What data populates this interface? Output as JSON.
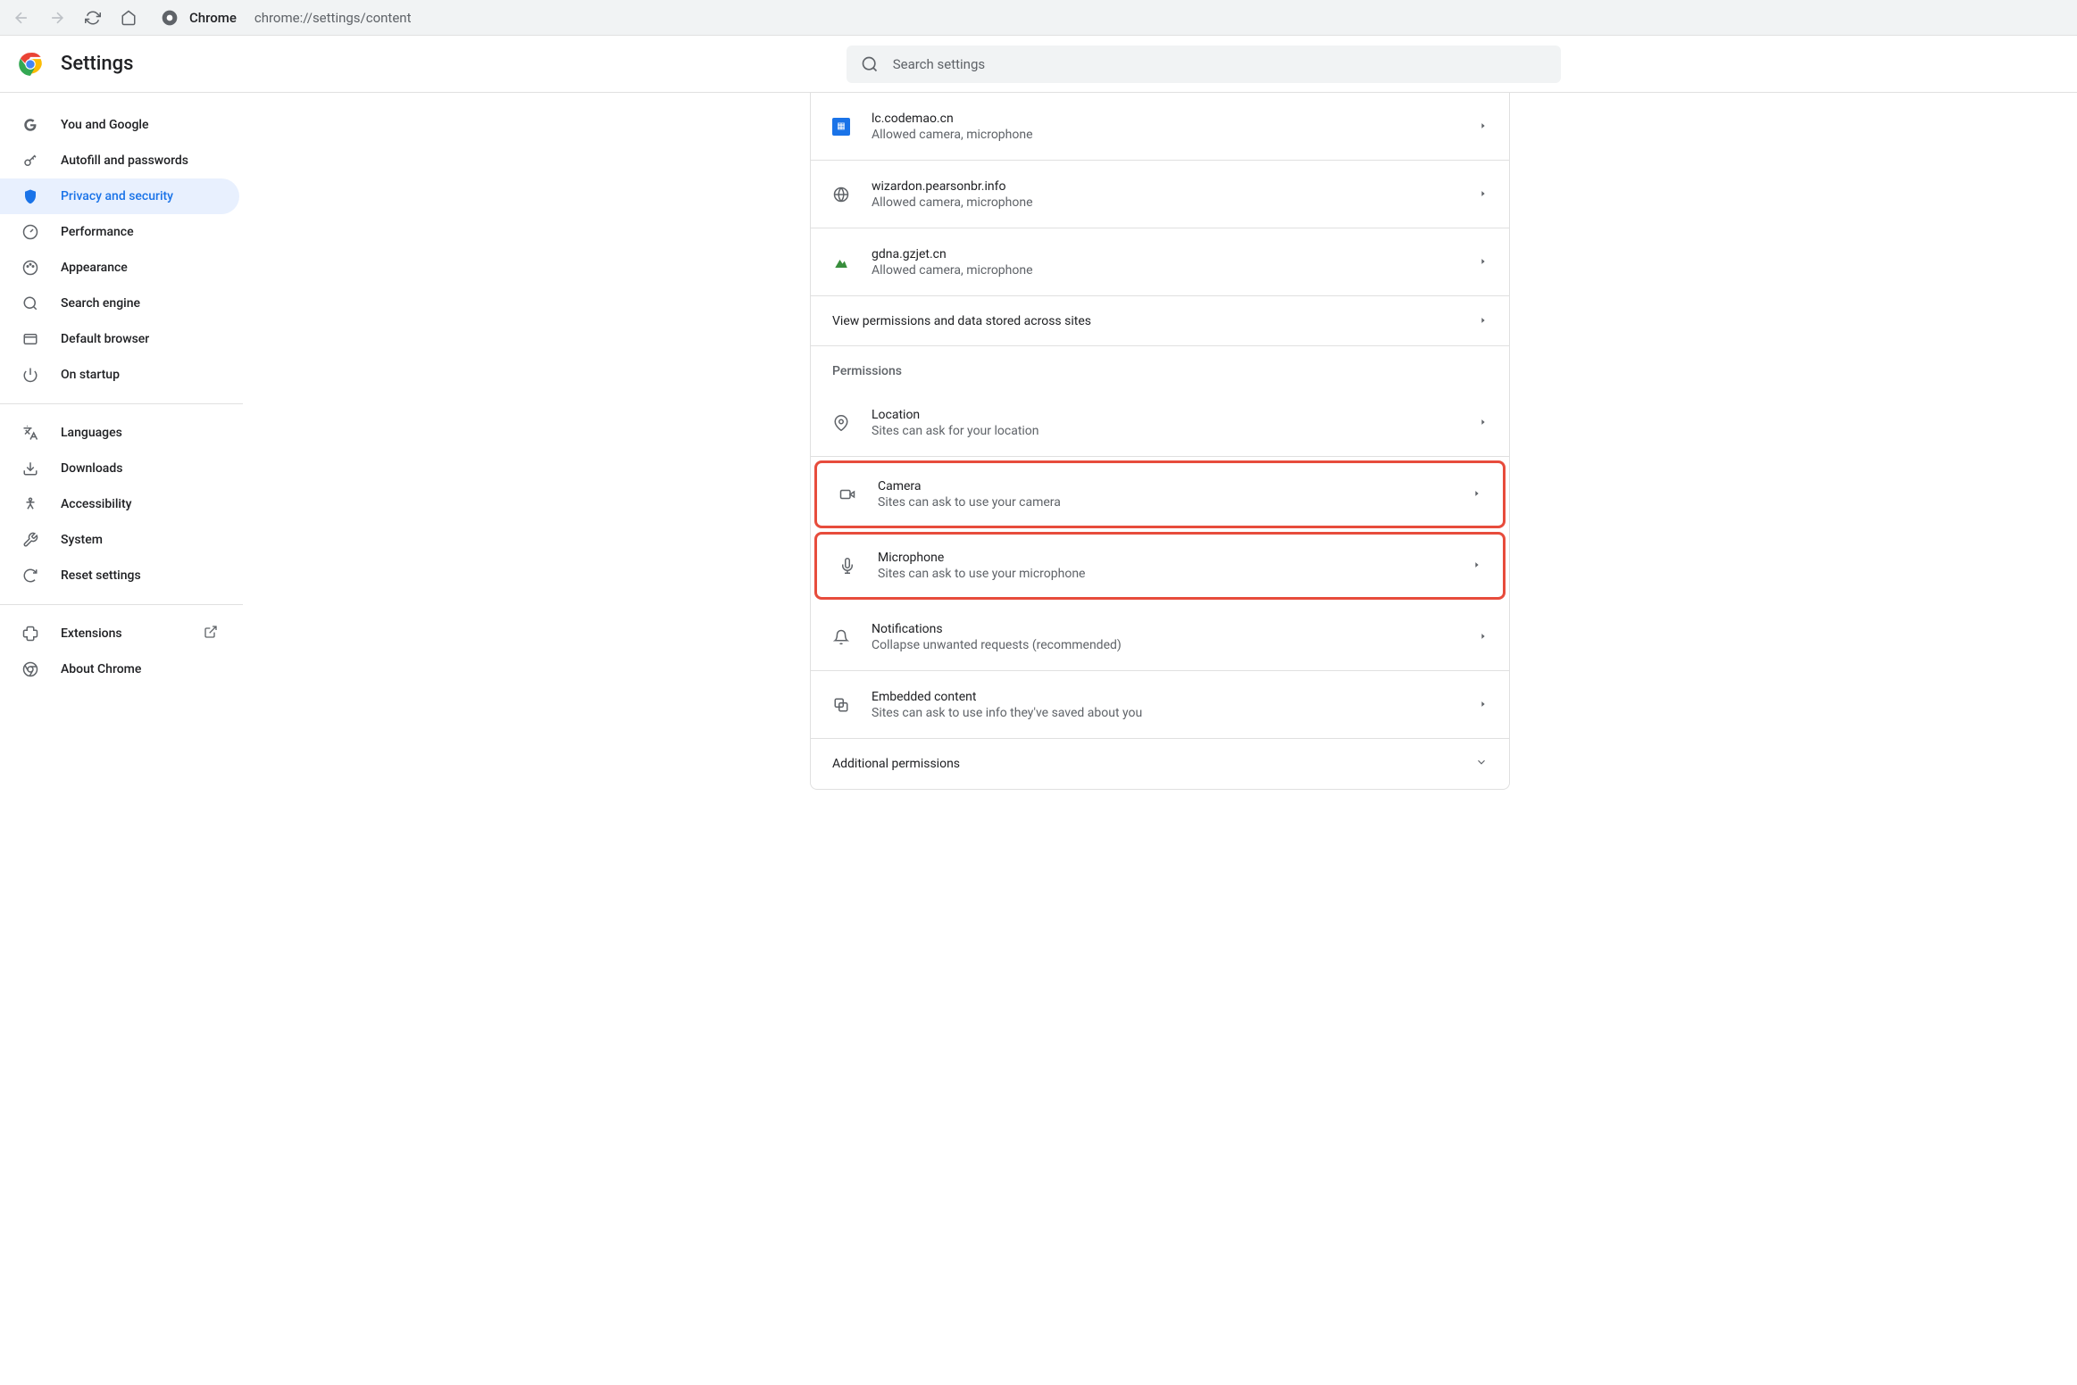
{
  "browser": {
    "label": "Chrome",
    "url": "chrome://settings/content"
  },
  "header": {
    "title": "Settings",
    "search_placeholder": "Search settings"
  },
  "sidebar": {
    "group1": [
      {
        "id": "you-and-google",
        "label": "You and Google"
      },
      {
        "id": "autofill",
        "label": "Autofill and passwords"
      },
      {
        "id": "privacy",
        "label": "Privacy and security",
        "active": true
      },
      {
        "id": "performance",
        "label": "Performance"
      },
      {
        "id": "appearance",
        "label": "Appearance"
      },
      {
        "id": "search-engine",
        "label": "Search engine"
      },
      {
        "id": "default-browser",
        "label": "Default browser"
      },
      {
        "id": "on-startup",
        "label": "On startup"
      }
    ],
    "group2": [
      {
        "id": "languages",
        "label": "Languages"
      },
      {
        "id": "downloads",
        "label": "Downloads"
      },
      {
        "id": "accessibility",
        "label": "Accessibility"
      },
      {
        "id": "system",
        "label": "System"
      },
      {
        "id": "reset",
        "label": "Reset settings"
      }
    ],
    "group3": [
      {
        "id": "extensions",
        "label": "Extensions"
      },
      {
        "id": "about",
        "label": "About Chrome"
      }
    ]
  },
  "content": {
    "recent_sites": [
      {
        "domain": "lc.codemao.cn",
        "status": "Allowed camera, microphone",
        "icon": "blue"
      },
      {
        "domain": "wizardon.pearsonbr.info",
        "status": "Allowed camera, microphone",
        "icon": "globe"
      },
      {
        "domain": "gdna.gzjet.cn",
        "status": "Allowed camera, microphone",
        "icon": "mountain"
      }
    ],
    "view_permissions": "View permissions and data stored across sites",
    "permissions_title": "Permissions",
    "permissions": [
      {
        "id": "location",
        "title": "Location",
        "subtitle": "Sites can ask for your location",
        "highlighted": false
      },
      {
        "id": "camera",
        "title": "Camera",
        "subtitle": "Sites can ask to use your camera",
        "highlighted": true
      },
      {
        "id": "microphone",
        "title": "Microphone",
        "subtitle": "Sites can ask to use your microphone",
        "highlighted": true
      },
      {
        "id": "notifications",
        "title": "Notifications",
        "subtitle": "Collapse unwanted requests (recommended)",
        "highlighted": false
      },
      {
        "id": "embedded",
        "title": "Embedded content",
        "subtitle": "Sites can ask to use info they've saved about you",
        "highlighted": false
      }
    ],
    "additional_permissions": "Additional permissions"
  }
}
